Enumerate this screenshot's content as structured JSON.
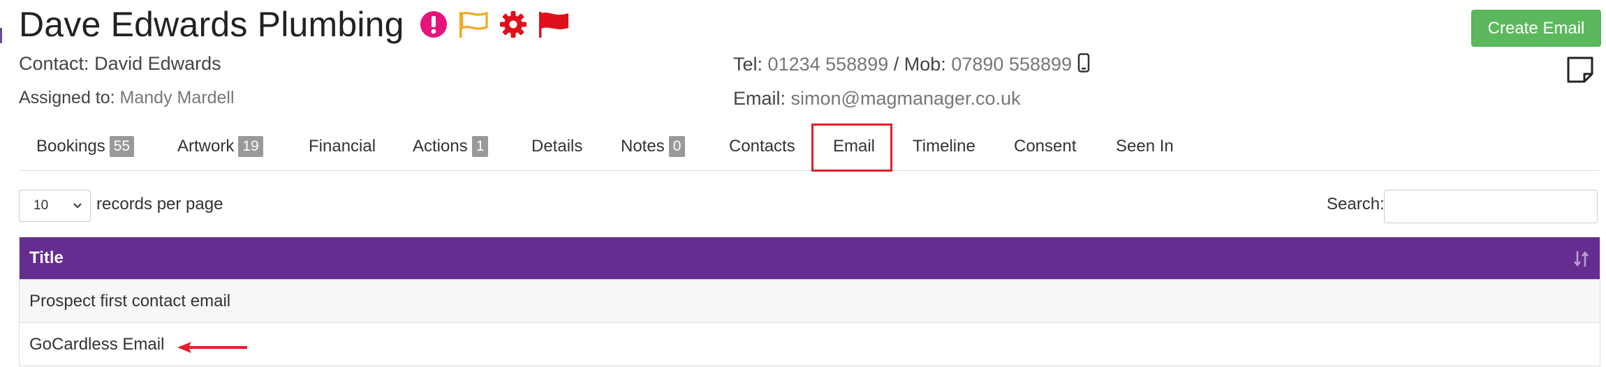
{
  "header": {
    "title": "Dave Edwards Plumbing",
    "icons": [
      "exclamation-circle-icon",
      "flag-outline-icon",
      "gear-icon",
      "flag-filled-icon"
    ],
    "create_email_label": "Create Email",
    "note_icon": "sticky-note-icon"
  },
  "contact": {
    "contact_label": "Contact:",
    "contact_value": "David Edwards",
    "assigned_label": "Assigned to:",
    "assigned_value": "Mandy Mardell",
    "tel_label": "Tel:",
    "tel_value": "01234 558899",
    "separator": "/",
    "mob_label": "Mob:",
    "mob_value": "07890 558899",
    "mobile_icon": "mobile-phone-icon",
    "email_label": "Email:",
    "email_value": "simon@magmanager.co.uk"
  },
  "tabs": [
    {
      "label": "Bookings",
      "badge": "55"
    },
    {
      "label": "Artwork",
      "badge": "19"
    },
    {
      "label": "Financial",
      "badge": ""
    },
    {
      "label": "Actions",
      "badge": "1"
    },
    {
      "label": "Details",
      "badge": ""
    },
    {
      "label": "Notes",
      "badge": "0"
    },
    {
      "label": "Contacts",
      "badge": ""
    },
    {
      "label": "Email",
      "badge": ""
    },
    {
      "label": "Timeline",
      "badge": ""
    },
    {
      "label": "Consent",
      "badge": ""
    },
    {
      "label": "Seen In",
      "badge": ""
    }
  ],
  "active_tab": "Email",
  "table_controls": {
    "page_length": "10",
    "page_length_suffix": "records per page",
    "search_label": "Search:",
    "search_value": ""
  },
  "table": {
    "header": "Title",
    "rows": [
      "Prospect first contact email",
      "GoCardless Email"
    ]
  },
  "colors": {
    "header_purple": "#662d91",
    "create_button_green": "#5cb85c",
    "highlight_red": "#e0202a",
    "exclamation_pink": "#e5137a",
    "flag_orange": "#f5a623",
    "gear_red": "#e0101a"
  }
}
